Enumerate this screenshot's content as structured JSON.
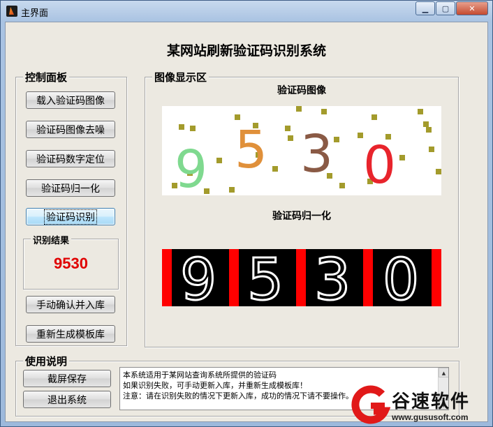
{
  "window": {
    "title": "主界面"
  },
  "main_title": "某网站刷新验证码识别系统",
  "control_panel": {
    "label": "控制面板",
    "buttons": [
      "载入验证码图像",
      "验证码图像去噪",
      "验证码数字定位",
      "验证码归一化",
      "验证码识别",
      "手动确认并入库",
      "重新生成模板库"
    ]
  },
  "result": {
    "label": "识别结果",
    "value": "9530"
  },
  "display_area": {
    "label": "图像显示区",
    "captcha_title": "验证码图像",
    "normalized_title": "验证码归一化",
    "captcha_digits": [
      "9",
      "5",
      "3",
      "0"
    ],
    "captcha_colors": [
      "#7fd98f",
      "#e0903a",
      "#8a5a45",
      "#e8242c"
    ],
    "normalized_digits": [
      "9",
      "5",
      "3",
      "0"
    ]
  },
  "usage": {
    "label": "使用说明",
    "buttons": [
      "截屏保存",
      "退出系统"
    ],
    "lines": [
      "本系统适用于某网站查询系统所提供的验证码",
      "如果识别失败，可手动更新入库，并重新生成模板库！",
      "注意：请在识别失败的情况下更新入库，成功的情况下请不要操作。"
    ]
  },
  "watermark": {
    "text": "谷速软件",
    "url": "www.gususoft.com"
  }
}
